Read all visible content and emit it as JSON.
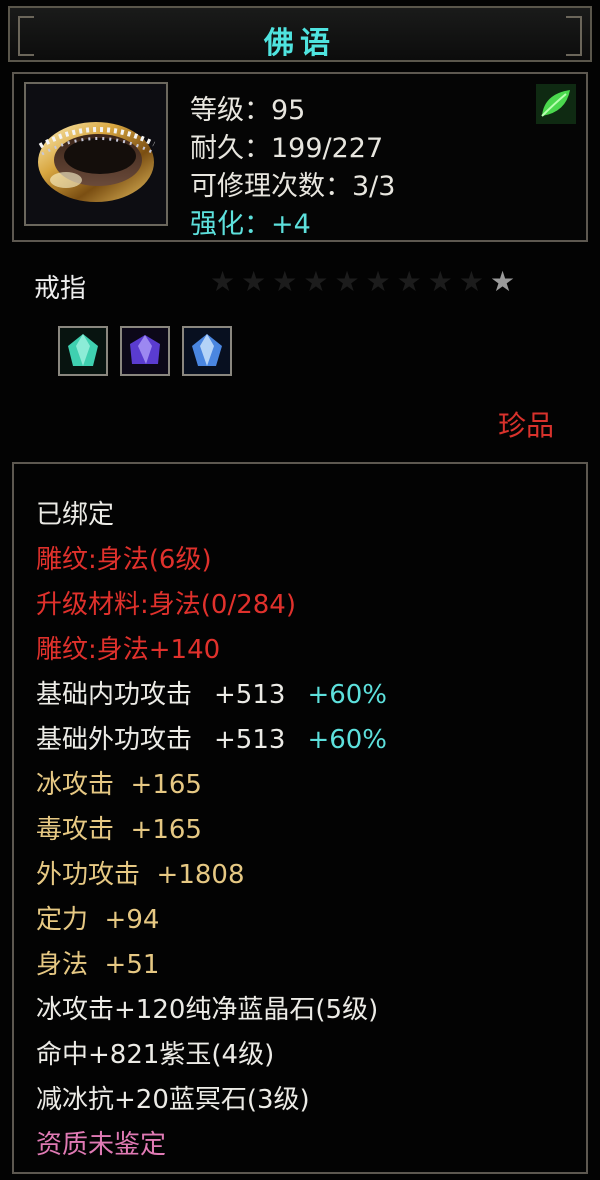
{
  "tooltip": {
    "title": "佛语",
    "colors": {
      "title": "#4fe3df",
      "normal": "#ecebe6",
      "red": "#e0312c",
      "gold": "#e6c883",
      "cyan": "#5de0dc",
      "pink": "#e07ab4",
      "border": "#5d5850"
    },
    "header": {
      "icon": "gold-ring-icon",
      "badge_icon": "green-leaf-icon",
      "level_label": "等级：",
      "level_value": "95",
      "durability_label": "耐久：",
      "durability_value": "199/227",
      "repair_label": "可修理次数：",
      "repair_value": "3/3",
      "enhance_label": "强化：",
      "enhance_value": "+4"
    },
    "item_type": "戒指",
    "stars": {
      "total": 10,
      "filled": 1
    },
    "gems": [
      "green-gem-icon",
      "purple-gem-icon",
      "blue-gem-icon"
    ],
    "rarity": "珍品",
    "attributes": {
      "bound": "已绑定",
      "engrave_1": "雕纹:身法(6级)",
      "upgrade_material": "升级材料:身法(0/284)",
      "engrave_2": "雕纹:身法+140",
      "base_inner_label": "基础内功攻击",
      "base_inner_value": "+513",
      "base_inner_pct": "+60%",
      "base_outer_label": "基础外功攻击",
      "base_outer_value": "+513",
      "base_outer_pct": "+60%",
      "ice_attack": "冰攻击  +165",
      "poison_attack": "毒攻击  +165",
      "outer_attack": "外功攻击  +1808",
      "focus": "定力  +94",
      "agility": "身法  +51",
      "gem_1": "冰攻击+120纯净蓝晶石(5级)",
      "gem_2": "命中+821紫玉(4级)",
      "gem_3": "减冰抗+20蓝冥石(3级)",
      "quality": "资质未鉴定"
    }
  }
}
